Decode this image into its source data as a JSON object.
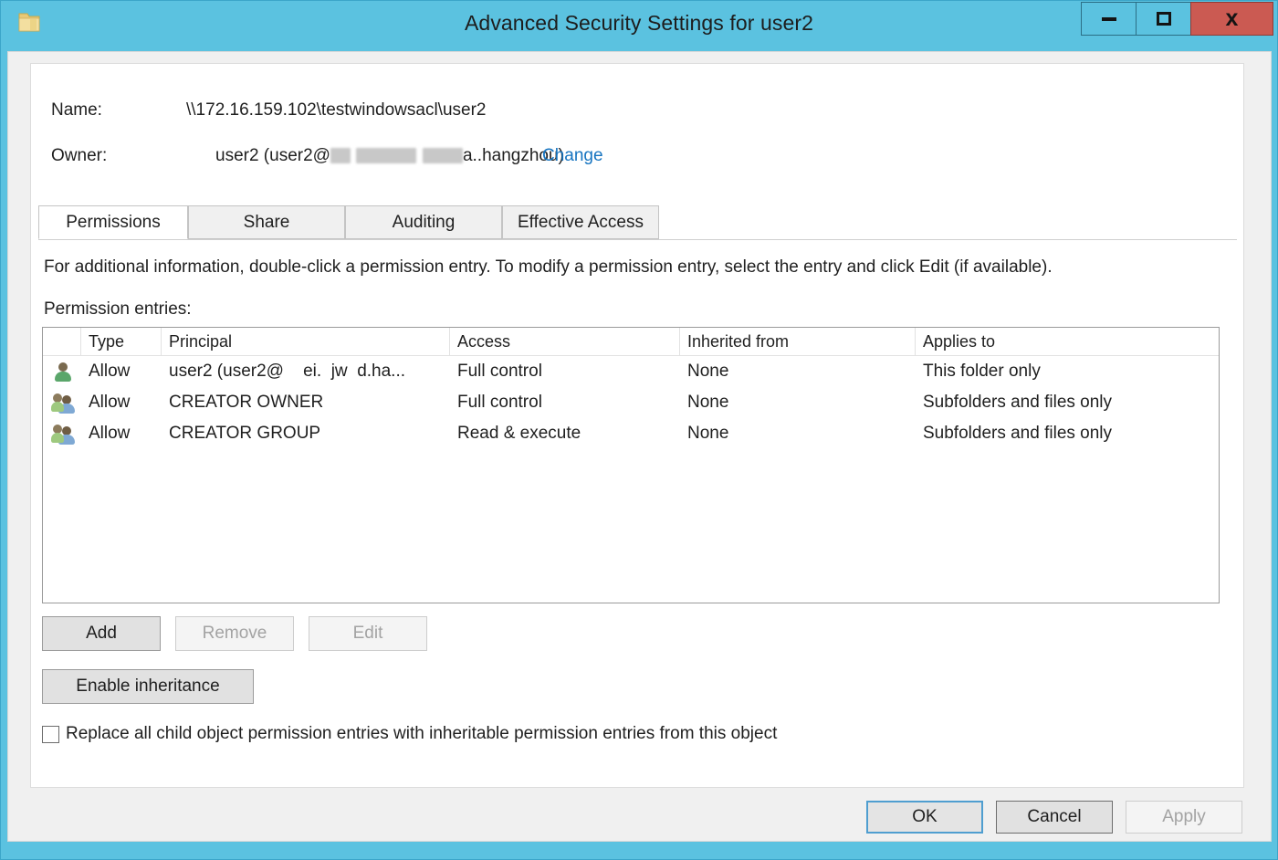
{
  "window": {
    "title": "Advanced Security Settings for user2",
    "icon": "folder-icon",
    "minimize_label": "–",
    "maximize_label": "□",
    "close_label": "x"
  },
  "header": {
    "name_label": "Name:",
    "name_value": "\\\\172.16.159.102\\testwindowsacl\\user2",
    "owner_label": "Owner:",
    "owner_value_prefix": "user2 (user2@",
    "owner_value_suffix": "a..hangzhou)",
    "change_link": "Change"
  },
  "tabs": [
    {
      "label": "Permissions",
      "active": true
    },
    {
      "label": "Share",
      "active": false
    },
    {
      "label": "Auditing",
      "active": false
    },
    {
      "label": "Effective Access",
      "active": false
    }
  ],
  "main": {
    "instruction": "For additional information, double-click a permission entry. To modify a permission entry, select the entry and click Edit (if available).",
    "entries_label": "Permission entries:"
  },
  "grid": {
    "columns": [
      "",
      "Type",
      "Principal",
      "Access",
      "Inherited from",
      "Applies to"
    ],
    "rows": [
      {
        "icon": "single-user-icon",
        "type": "Allow",
        "principal": "user2 (user2@    ei.  jw  d.ha...",
        "access": "Full control",
        "inherited_from": "None",
        "applies_to": "This folder only"
      },
      {
        "icon": "user-group-icon",
        "type": "Allow",
        "principal": "CREATOR OWNER",
        "access": "Full control",
        "inherited_from": "None",
        "applies_to": "Subfolders and files only"
      },
      {
        "icon": "user-group-icon",
        "type": "Allow",
        "principal": "CREATOR GROUP",
        "access": "Read & execute",
        "inherited_from": "None",
        "applies_to": "Subfolders and files only"
      }
    ]
  },
  "actions": {
    "add": "Add",
    "remove": "Remove",
    "edit": "Edit",
    "enable_inheritance": "Enable inheritance"
  },
  "replace_option": {
    "label": "Replace all child object permission entries with inheritable permission entries from this object",
    "checked": false
  },
  "footer": {
    "ok": "OK",
    "cancel": "Cancel",
    "apply": "Apply"
  },
  "colors": {
    "titlebar": "#5bc2e0",
    "close_button": "#cb5a52",
    "link": "#1674c0",
    "dialog_face": "#f0f0f0"
  }
}
